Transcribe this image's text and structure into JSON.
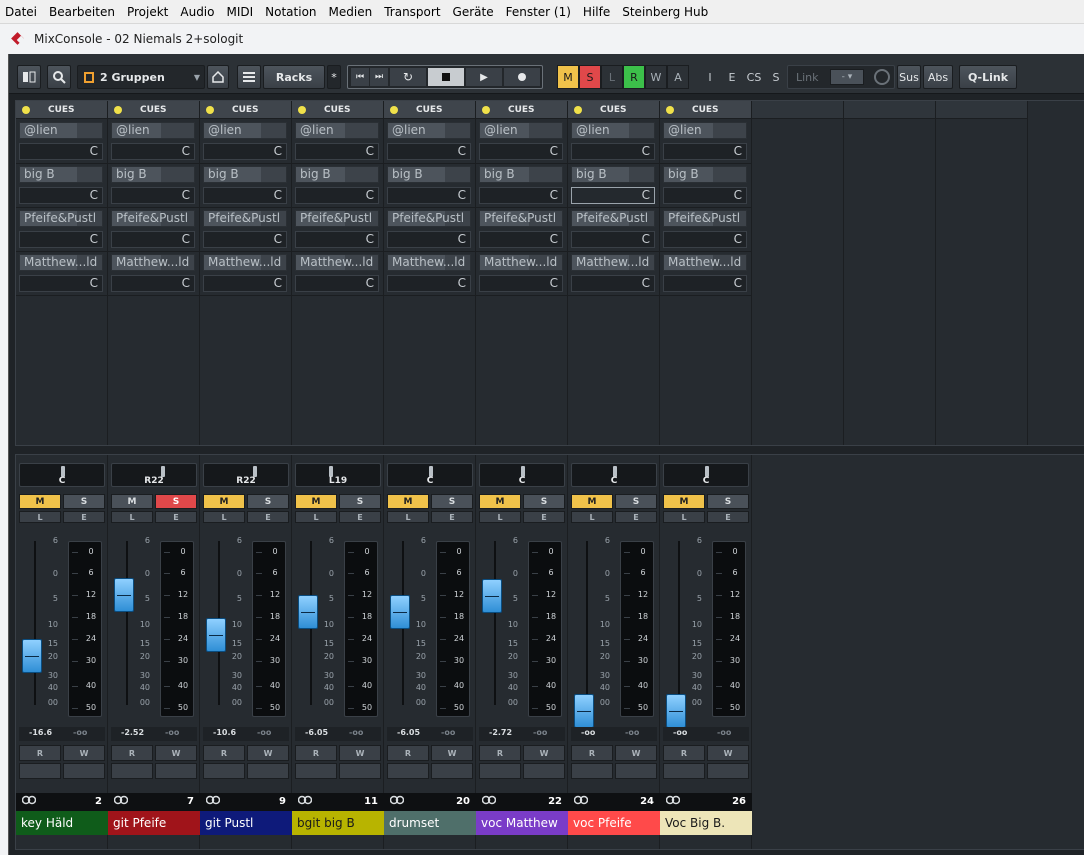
{
  "menu": [
    "Datei",
    "Bearbeiten",
    "Projekt",
    "Audio",
    "MIDI",
    "Notation",
    "Medien",
    "Transport",
    "Geräte",
    "Fenster (1)",
    "Hilfe",
    "Steinberg Hub"
  ],
  "window": {
    "title": "MixConsole - 02 Niemals 2+sologit"
  },
  "toolbar": {
    "group_select": "2 Gruppen",
    "racks_label": "Racks",
    "star": "*",
    "status_buttons": [
      "M",
      "S",
      "L",
      "R",
      "W",
      "A"
    ],
    "filter_buttons": [
      "I",
      "E",
      "CS",
      "S"
    ],
    "link_label": "Link",
    "link_value": "-",
    "sus_label": "Sus",
    "abs_label": "Abs",
    "qlink_label": "Q-Link",
    "colors": {
      "M": "#f0c24a",
      "S": "#e0484a",
      "R": "#3cc04a"
    }
  },
  "cues": {
    "header": "CUES",
    "sends": [
      "@lien",
      "big B",
      "Pfeife&Pustl",
      "Matthew...ld"
    ],
    "pan_value": "C"
  },
  "scale": {
    "fader": [
      "6",
      "0",
      "5",
      "10",
      "15",
      "20",
      "30",
      "40",
      "00"
    ],
    "meter": [
      "0",
      "6",
      "12",
      "18",
      "24",
      "30",
      "40",
      "50"
    ]
  },
  "labels": {
    "M": "M",
    "S": "S",
    "L": "L",
    "E": "E",
    "R": "R",
    "W": "W"
  },
  "channels": [
    {
      "name": "key Häld",
      "number": "2",
      "pan": "C",
      "volume": "-16.6",
      "peak": "-oo",
      "mute": true,
      "solo": false,
      "color": "#0f5c1a",
      "text_color": "#ffffff",
      "fader_level": -16.6
    },
    {
      "name": "git Pfeife",
      "number": "7",
      "pan": "R22",
      "volume": "-2.52",
      "peak": "-oo",
      "mute": false,
      "solo": true,
      "color": "#a0141a",
      "text_color": "#ffffff",
      "fader_level": -2.52
    },
    {
      "name": "git Pustl",
      "number": "9",
      "pan": "R22",
      "volume": "-10.6",
      "peak": "-oo",
      "mute": true,
      "solo": false,
      "color": "#0e1a7a",
      "text_color": "#ffffff",
      "fader_level": -10.6
    },
    {
      "name": "bgit big B",
      "number": "11",
      "pan": "L19",
      "volume": "-6.05",
      "peak": "-oo",
      "mute": true,
      "solo": false,
      "color": "#b8b400",
      "text_color": "#1a1a1a",
      "fader_level": -6.05
    },
    {
      "name": "drumset",
      "number": "20",
      "pan": "C",
      "volume": "-6.05",
      "peak": "-oo",
      "mute": true,
      "solo": false,
      "color": "#4f6f6a",
      "text_color": "#ffffff",
      "fader_level": -6.05
    },
    {
      "name": "voc Matthew",
      "number": "22",
      "pan": "C",
      "volume": "-2.72",
      "peak": "-oo",
      "mute": true,
      "solo": false,
      "color": "#7a3cc8",
      "text_color": "#ffffff",
      "fader_level": -2.72
    },
    {
      "name": "voc Pfeife",
      "number": "24",
      "pan": "C",
      "volume": "-oo",
      "peak": "-oo",
      "mute": true,
      "solo": false,
      "color": "#ff4a4a",
      "text_color": "#ffffff",
      "fader_level": -90
    },
    {
      "name": "Voc Big B.",
      "number": "26",
      "pan": "C",
      "volume": "-oo",
      "peak": "-oo",
      "mute": true,
      "solo": false,
      "color": "#ede5b8",
      "text_color": "#1a1a1a",
      "fader_level": -90
    }
  ]
}
